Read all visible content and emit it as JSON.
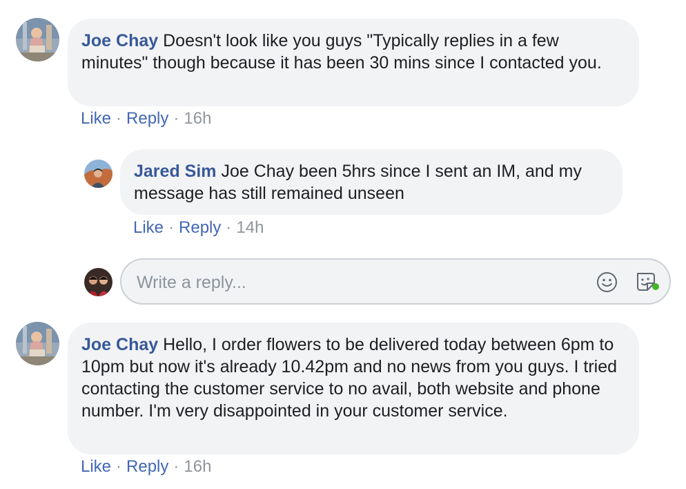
{
  "comments": [
    {
      "author": "Joe Chay",
      "text": "Doesn't look like you guys \"Typically replies in a few minutes\" though because it has been 30 mins since I contacted you.",
      "like": "Like",
      "reply": "Reply",
      "time": "16h",
      "sep": "·"
    },
    {
      "author": "Jared Sim",
      "text": "Joe Chay been 5hrs since I sent an IM, and my message has still remained unseen",
      "like": "Like",
      "reply": "Reply",
      "time": "14h",
      "sep": "·"
    },
    {
      "author": "Joe Chay",
      "text": "Hello, I order flowers to be delivered today between 6pm to 10pm but now it's already 10.42pm and no news from you guys. I tried contacting the customer service to no avail, both website and phone number. I'm very disappointed in your customer service.",
      "like": "Like",
      "reply": "Reply",
      "time": "16h",
      "sep": "·"
    }
  ],
  "reply_box": {
    "placeholder": "Write a reply..."
  },
  "colors": {
    "author": "#385898",
    "link": "#4267b2",
    "bubble": "#f2f3f5",
    "meta": "#90949c",
    "online_dot": "#42b72a"
  },
  "icons": {
    "emoji": "smiley-emoji-icon",
    "sticker": "sticker-icon"
  }
}
